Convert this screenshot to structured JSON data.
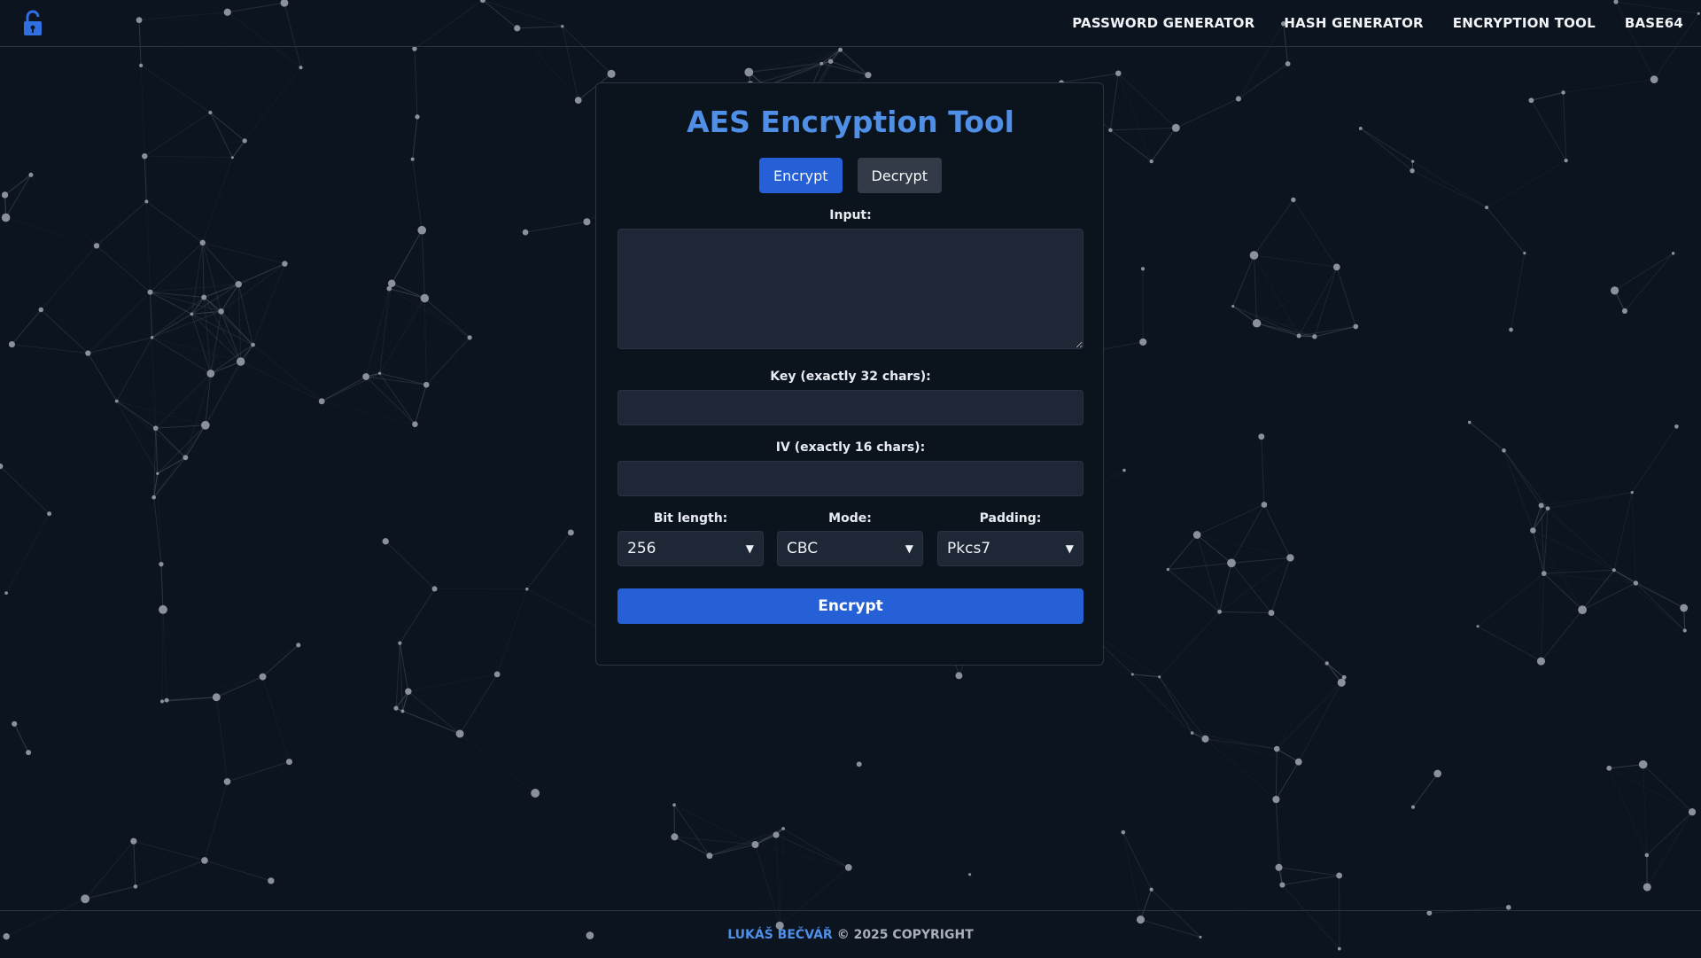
{
  "nav": {
    "items": [
      "PASSWORD GENERATOR",
      "HASH GENERATOR",
      "ENCRYPTION TOOL",
      "BASE64"
    ]
  },
  "logo_icon": "lock-open-icon",
  "card": {
    "title": "AES Encryption Tool",
    "tabs": {
      "encrypt": "Encrypt",
      "decrypt": "Decrypt",
      "active": "encrypt"
    },
    "input_label": "Input:",
    "input_value": "",
    "key_label": "Key (exactly 32 chars):",
    "key_value": "",
    "iv_label": "IV (exactly 16 chars):",
    "iv_value": "",
    "bit_length": {
      "label": "Bit length:",
      "value": "256"
    },
    "mode": {
      "label": "Mode:",
      "value": "CBC"
    },
    "padding": {
      "label": "Padding:",
      "value": "Pkcs7"
    },
    "submit_label": "Encrypt"
  },
  "footer": {
    "author": "LUKÁŠ BEČVÁŘ",
    "copyright": "© 2025 COPYRIGHT"
  },
  "colors": {
    "background": "#0c141f",
    "accent": "#2560d6",
    "title": "#4f8fe6",
    "field": "#1e2735"
  }
}
